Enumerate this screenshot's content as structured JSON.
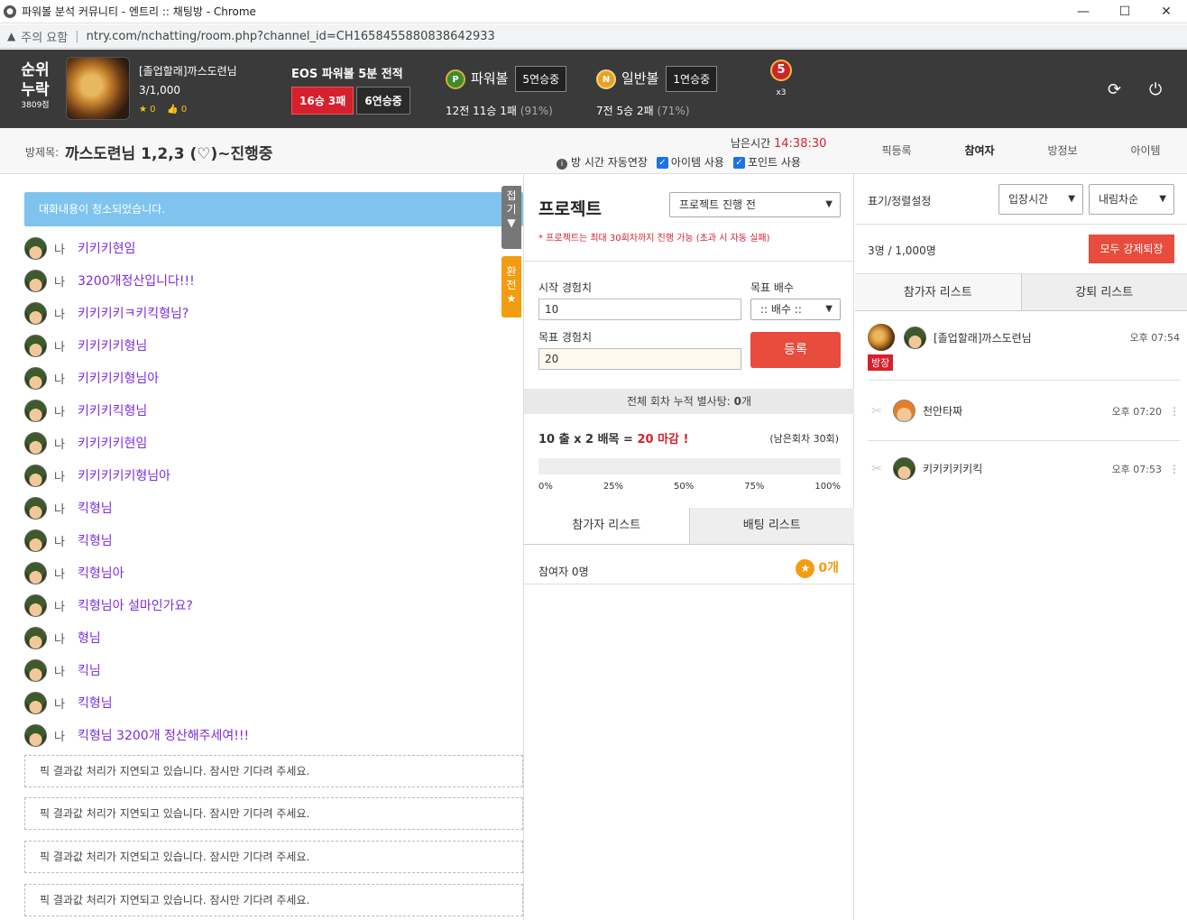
{
  "browser": {
    "title": "파워볼 분석 커뮤니티 - 엔트리 :: 채팅방 - Chrome",
    "warning": "주의 요함",
    "url": "ntry.com/nchatting/room.php?channel_id=CH1658455880838642933"
  },
  "header": {
    "rank_line1": "순위",
    "rank_line2": "누락",
    "rank_points": "3809점",
    "user_name": "[졸업할래]까스도련님",
    "user_count": "3/1,000",
    "star_count": "0",
    "like_count": "0",
    "eos_title": "EOS 파워볼 5분 전적",
    "eos_record": "16승 3패",
    "eos_streak": "6연승중",
    "powerball_icon": "P",
    "powerball_label": "파워볼",
    "powerball_streak": "5연승중",
    "powerball_record_a": "12전 11승 1패",
    "powerball_pct": "(91%)",
    "normal_icon": "N",
    "normal_label": "일반볼",
    "normal_streak": "1연승중",
    "normal_record_a": "7전 5승 2패",
    "normal_pct": "(71%)",
    "medal_num": "5",
    "medal_mult": "x3"
  },
  "room": {
    "title_label": "방제목:",
    "title": "까스도련님 1,2,3 (♡)~진행중",
    "remain_label": "남은시간",
    "remain_time": "14:38:30",
    "opt_extend": "방 시간 자동연장",
    "opt_item": "아이템 사용",
    "opt_point": "포인트 사용",
    "tabs": [
      "픽등록",
      "참여자",
      "방정보",
      "아이템"
    ]
  },
  "chat": {
    "notice": "대화내용이 청소되었습니다.",
    "fold_label": [
      "접",
      "기"
    ],
    "switch_label": [
      "환",
      "전"
    ],
    "me_label": "나",
    "messages": [
      "키키키현임",
      "3200개정산입니다!!!",
      "키키키키ㅋ키킥형님?",
      "키키키키형님",
      "키키키키형님아",
      "키키키킥형님",
      "키키키키현임",
      "키키키키키형님아",
      "킥형님",
      "킥형님",
      "킥형님아",
      "킥형님아 설마인가요?",
      "형님",
      "킥님",
      "킥형님",
      "킥형님 3200개 정산해주세여!!!"
    ],
    "system_msg": "픽 결과값 처리가 지연되고 있습니다. 잠시만 기다려 주세요."
  },
  "project": {
    "title": "프로젝트",
    "status_select": "프로젝트 진행 전",
    "note": "* 프로젝트는 최대 30회차까지 진행 가능 (초과 시 자동 실패)",
    "start_exp_label": "시작 경험치",
    "start_exp_value": "10",
    "target_mult_label": "목표 배수",
    "target_mult_select": ":: 배수 ::",
    "target_exp_label": "목표 경험치",
    "target_exp_value": "20",
    "register": "등록",
    "accum_label": "전체 회차 누적 별사탕:",
    "accum_value": "0",
    "accum_unit": "개",
    "formula_a": "10 출 x 2 배목 =",
    "formula_b": "20 마감 !",
    "remaining_rounds": "(남은회차 30회)",
    "progress": 0,
    "ticks": [
      "0%",
      "25%",
      "50%",
      "75%",
      "100%"
    ],
    "tab_participants": "참가자 리스트",
    "tab_bets": "배팅 리스트",
    "participant_count": "참여자 0명",
    "point_total": "0개"
  },
  "participants": {
    "sort_label": "표기/정렬설정",
    "sort_select_a": "입장시간",
    "sort_select_b": "내림차순",
    "count": "3명 / 1,000명",
    "kick_all": "모두 강제퇴장",
    "tab_list": "참가자 리스트",
    "tab_kicked": "강퇴 리스트",
    "host_tag": "방장",
    "users": [
      {
        "name": "[졸업할래]까스도련님",
        "time": "오후 07:54"
      },
      {
        "name": "천안타짜",
        "time": "오후 07:20"
      },
      {
        "name": "키키키키키킥",
        "time": "오후 07:53"
      }
    ]
  }
}
